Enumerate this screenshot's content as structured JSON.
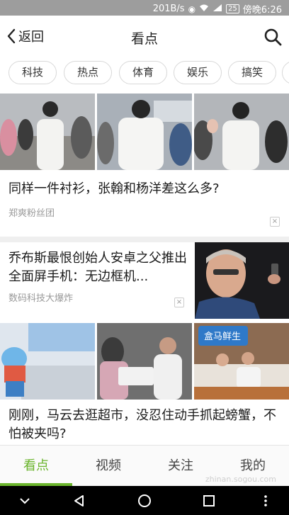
{
  "status_bar": {
    "speed": "201B/s",
    "battery": "25",
    "time": "傍晚6:26"
  },
  "header": {
    "back_label": "返回",
    "title": "看点"
  },
  "categories": [
    "科技",
    "热点",
    "体育",
    "娱乐",
    "搞笑"
  ],
  "feed": [
    {
      "headline": "同样一件衬衫，张翰和杨洋差这么多?",
      "source": "郑爽粉丝团"
    },
    {
      "headline": "乔布斯最恨创始人安卓之父推出全面屏手机：无边框机...",
      "source": "数码科技大爆炸"
    },
    {
      "headline": "刚刚，马云去逛超市，没忍住动手抓起螃蟹，不怕被夹吗?",
      "store_sign": "盒马鲜生"
    }
  ],
  "bottom_nav": [
    "看点",
    "视频",
    "关注",
    "我的"
  ],
  "watermark": "zhinan.sogou.com",
  "colors": {
    "accent": "#6ab42c",
    "status_bar": "#9d9d9d"
  }
}
